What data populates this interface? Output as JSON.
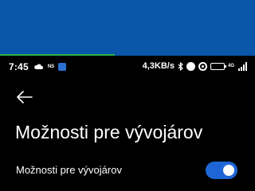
{
  "status_bar": {
    "time": "7:45",
    "network_label": "NS",
    "speed": "4,3KB/s",
    "lte_label": "4G"
  },
  "download_progress": 0.45,
  "page": {
    "title": "Možnosti pre vývojárov"
  },
  "settings": [
    {
      "label": "Možnosti pre vývojárov",
      "enabled": true
    }
  ],
  "colors": {
    "banner": "#0a56a8",
    "progress": "#2bb34a",
    "toggle_on": "#1e66d6"
  }
}
